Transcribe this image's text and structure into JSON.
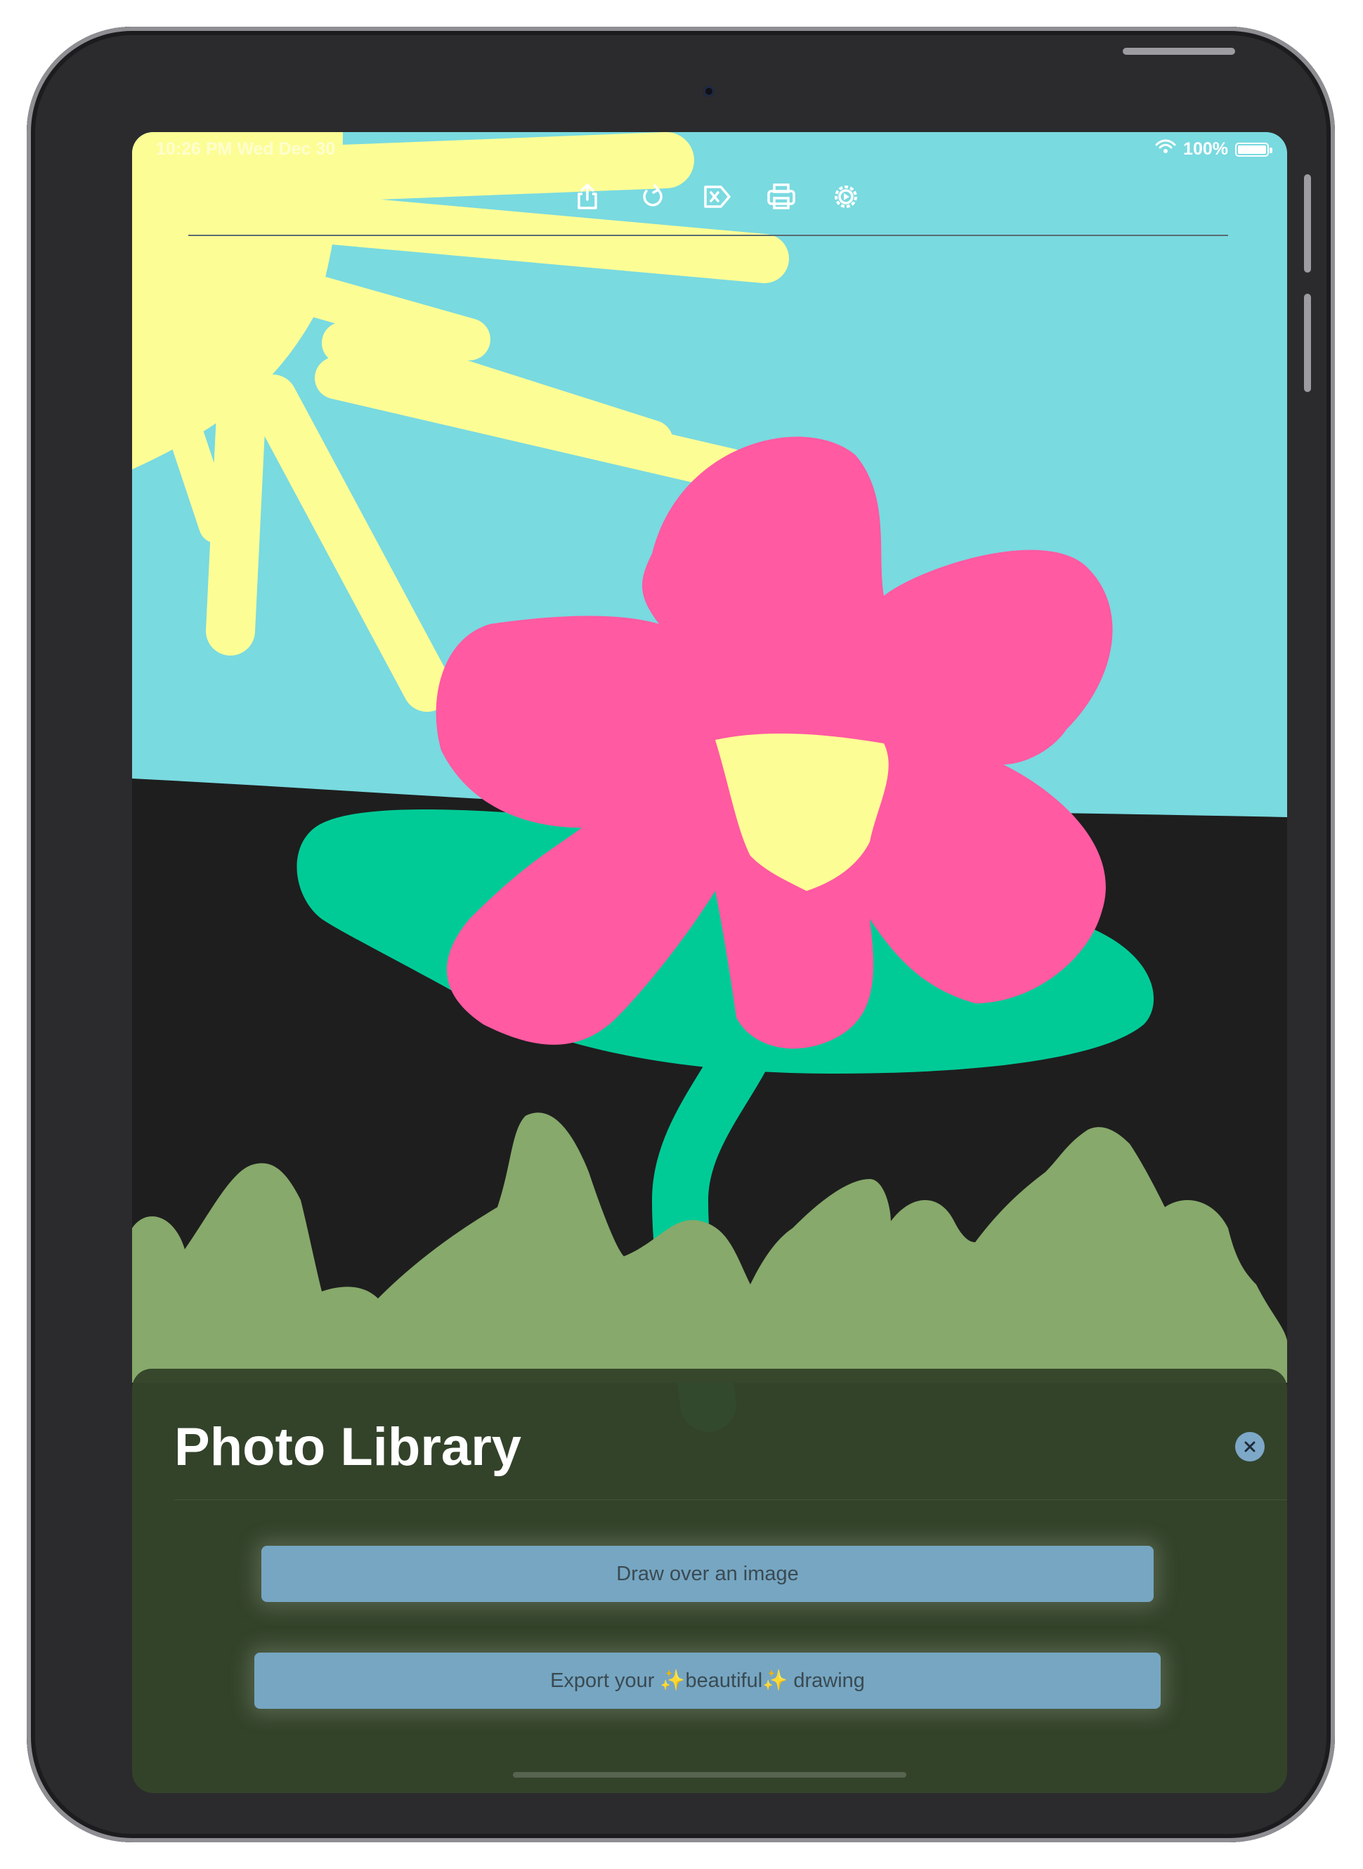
{
  "status_bar": {
    "time": "10:26 PM   Wed Dec 30",
    "battery": "100%",
    "battery_level": 1.0
  },
  "toolbar": {
    "icons": [
      "share-icon",
      "undo-icon",
      "clear-icon",
      "print-icon",
      "settings-icon"
    ]
  },
  "canvas": {
    "colors": {
      "sky": "#79dae0",
      "ground": "#1e1e1e",
      "sun": "#fdfd96",
      "petals": "#ff5aa2",
      "leaf": "#00cb97",
      "grass": "#87a96b"
    }
  },
  "sheet": {
    "title": "Photo Library",
    "close_icon": "close-icon",
    "actions": [
      {
        "label": "Draw over an image"
      },
      {
        "label": "Export your ✨beautiful✨ drawing"
      }
    ]
  }
}
